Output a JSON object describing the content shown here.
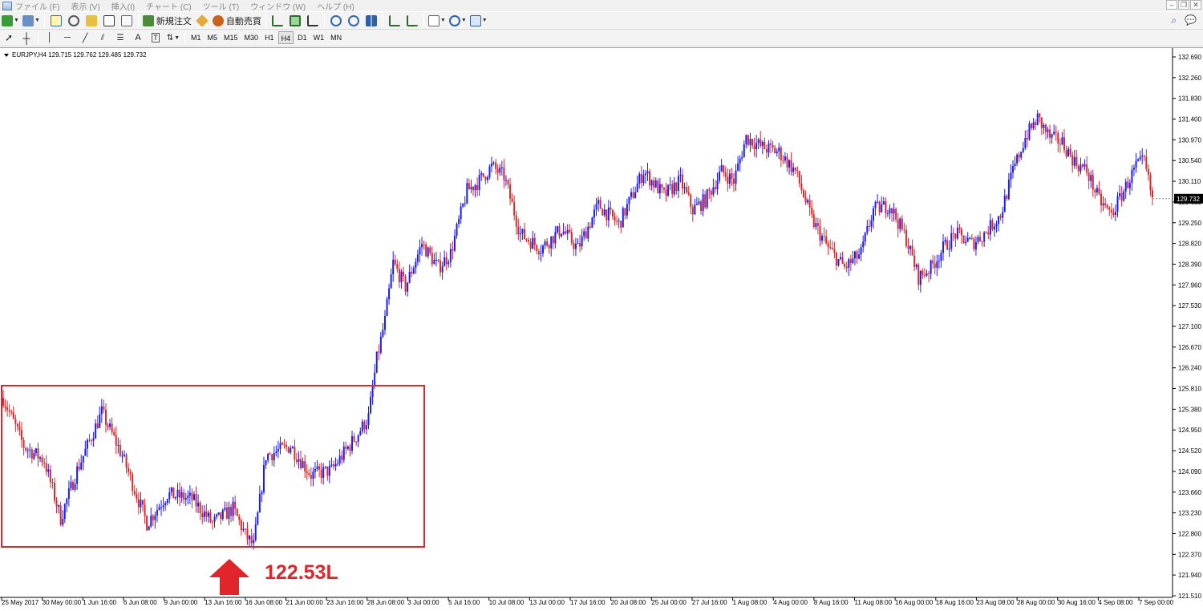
{
  "menu": {
    "items": [
      "ファイル (F)",
      "表示 (V)",
      "挿入(I)",
      "チャート (C)",
      "ツール (T)",
      "ウィンドウ (W)",
      "ヘルプ (H)"
    ]
  },
  "toolbar": {
    "new_order_label": "新規注文",
    "auto_trade_label": "自動売買",
    "timeframes": [
      "M1",
      "M5",
      "M15",
      "M30",
      "H1",
      "H4",
      "D1",
      "W1",
      "MN"
    ],
    "active_timeframe": "H4",
    "text_tool_label": "A"
  },
  "chart": {
    "symbol_line": "EURJPY,H4  129.715 129.762 129.485 129.732",
    "current_price": "129.732",
    "price_labels": [
      "132.690",
      "132.260",
      "131.830",
      "131.400",
      "130.970",
      "130.540",
      "130.110",
      "129.680",
      "129.250",
      "128.820",
      "128.390",
      "127.960",
      "127.530",
      "127.100",
      "126.670",
      "126.240",
      "125.810",
      "125.380",
      "124.950",
      "124.520",
      "124.090",
      "123.660",
      "123.230",
      "122.800",
      "122.370",
      "121.940",
      "121.510"
    ],
    "date_labels": [
      "25 May 2017",
      "30 May 00:00",
      "1 Jun 16:00",
      "6 Jun 08:00",
      "9 Jun 00:00",
      "13 Jun 16:00",
      "16 Jun 08:00",
      "21 Jun 00:00",
      "23 Jun 16:00",
      "28 Jun 08:00",
      "3 Jul 00:00",
      "5 Jul 16:00",
      "10 Jul 08:00",
      "13 Jul 00:00",
      "17 Jul 16:00",
      "20 Jul 08:00",
      "25 Jul 00:00",
      "27 Jul 16:00",
      "1 Aug 08:00",
      "4 Aug 00:00",
      "8 Aug 16:00",
      "11 Aug 08:00",
      "16 Aug 00:00",
      "18 Aug 16:00",
      "23 Aug 08:00",
      "28 Aug 00:00",
      "30 Aug 16:00",
      "4 Sep 08:00",
      "7 Sep 00:00"
    ],
    "annotation": "122.53L",
    "colors": {
      "bull": "#1a1aff",
      "bear": "#e0262a",
      "highlight": "#e0262a"
    }
  },
  "chart_data": {
    "type": "candlestick",
    "title": "EURJPY,H4",
    "ylim": [
      121.51,
      132.69
    ],
    "x_range": [
      "25 May 2017",
      "8 Sep 2017"
    ],
    "approximate_close_path": [
      [
        0,
        125.6
      ],
      [
        10,
        124.6
      ],
      [
        20,
        124.3
      ],
      [
        28,
        123.1
      ],
      [
        36,
        124.1
      ],
      [
        48,
        125.3
      ],
      [
        58,
        124.4
      ],
      [
        70,
        123.0
      ],
      [
        80,
        123.6
      ],
      [
        92,
        123.5
      ],
      [
        102,
        123.0
      ],
      [
        112,
        123.3
      ],
      [
        118,
        122.75
      ],
      [
        122,
        122.53
      ],
      [
        128,
        124.4
      ],
      [
        140,
        124.6
      ],
      [
        150,
        124.0
      ],
      [
        160,
        124.1
      ],
      [
        172,
        124.8
      ],
      [
        178,
        125.2
      ],
      [
        182,
        126.4
      ],
      [
        186,
        127.2
      ],
      [
        190,
        128.4
      ],
      [
        196,
        127.9
      ],
      [
        204,
        128.8
      ],
      [
        212,
        128.3
      ],
      [
        218,
        128.6
      ],
      [
        226,
        129.9
      ],
      [
        232,
        130.1
      ],
      [
        238,
        130.4
      ],
      [
        244,
        130.2
      ],
      [
        252,
        129.0
      ],
      [
        262,
        128.7
      ],
      [
        272,
        129.1
      ],
      [
        280,
        128.7
      ],
      [
        290,
        129.6
      ],
      [
        300,
        129.2
      ],
      [
        312,
        130.3
      ],
      [
        322,
        129.8
      ],
      [
        330,
        130.1
      ],
      [
        336,
        129.5
      ],
      [
        342,
        129.7
      ],
      [
        350,
        130.3
      ],
      [
        356,
        130.1
      ],
      [
        362,
        131.0
      ],
      [
        370,
        130.8
      ],
      [
        378,
        130.7
      ],
      [
        386,
        130.3
      ],
      [
        394,
        129.3
      ],
      [
        402,
        128.7
      ],
      [
        410,
        128.3
      ],
      [
        418,
        128.6
      ],
      [
        424,
        129.5
      ],
      [
        432,
        129.6
      ],
      [
        440,
        128.9
      ],
      [
        446,
        128.1
      ],
      [
        452,
        128.3
      ],
      [
        458,
        128.7
      ],
      [
        464,
        129.0
      ],
      [
        472,
        128.8
      ],
      [
        478,
        129.0
      ],
      [
        486,
        129.4
      ],
      [
        492,
        130.3
      ],
      [
        498,
        131.0
      ],
      [
        504,
        131.4
      ],
      [
        510,
        131.0
      ],
      [
        516,
        130.9
      ],
      [
        522,
        130.5
      ],
      [
        528,
        130.3
      ],
      [
        534,
        129.7
      ],
      [
        540,
        129.4
      ],
      [
        546,
        129.9
      ],
      [
        552,
        130.4
      ],
      [
        556,
        130.5
      ],
      [
        560,
        129.7
      ]
    ],
    "annotation": {
      "label": "122.53L",
      "value": 122.53
    }
  }
}
